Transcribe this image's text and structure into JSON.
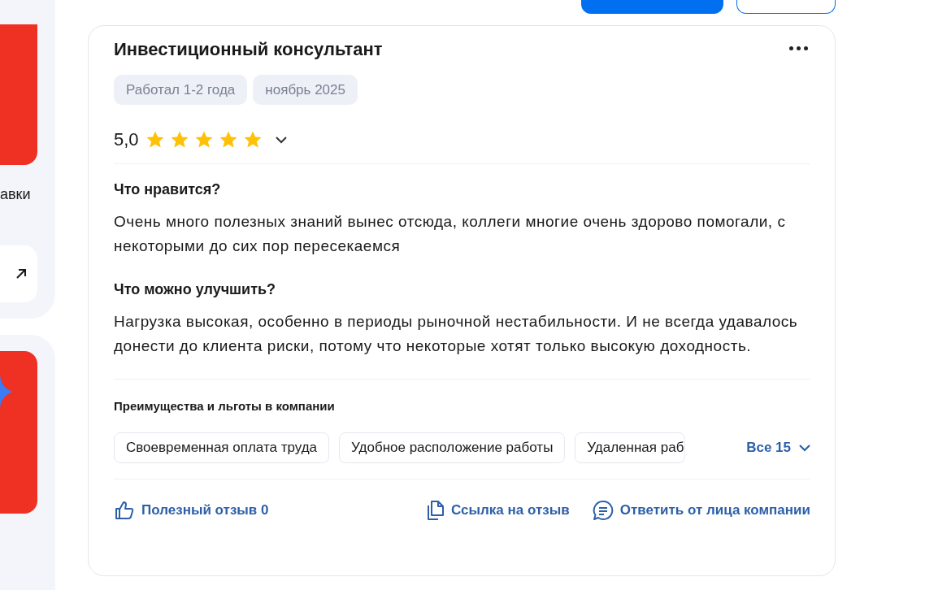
{
  "top_bar": {
    "buttons": [
      {
        "kind": "primary"
      },
      {
        "kind": "outline"
      }
    ]
  },
  "side_rail": {
    "caption": "авки"
  },
  "review": {
    "title": "Инвестиционный консультант",
    "tags": [
      "Работал 1-2 года",
      "ноябрь 2025"
    ],
    "rating": "5,0",
    "stars": 5,
    "sections": [
      {
        "heading": "Что нравится?",
        "text": "Очень много полезных знаний вынес отсюда, коллеги многие очень здорово помогали, с некоторыми до сих пор пересекаемся"
      },
      {
        "heading": "Что можно улучшить?",
        "text": "Нагрузка высокая, особенно в периоды рыночной нестабильности. И не всегда удавалось донести до клиента риски, потому что некоторые хотят только высокую доходность."
      }
    ],
    "benefits_heading": "Преимущества и льготы в компании",
    "benefits": [
      "Своевременная оплата труда",
      "Удобное расположение работы",
      "Удаленная раб"
    ],
    "benefits_more": "Все 15",
    "actions": [
      {
        "kind": "like",
        "label": "Полезный отзыв 0"
      },
      {
        "kind": "copy",
        "label": "Ссылка на отзыв"
      },
      {
        "kind": "reply",
        "label": "Ответить от лица компании"
      }
    ]
  }
}
